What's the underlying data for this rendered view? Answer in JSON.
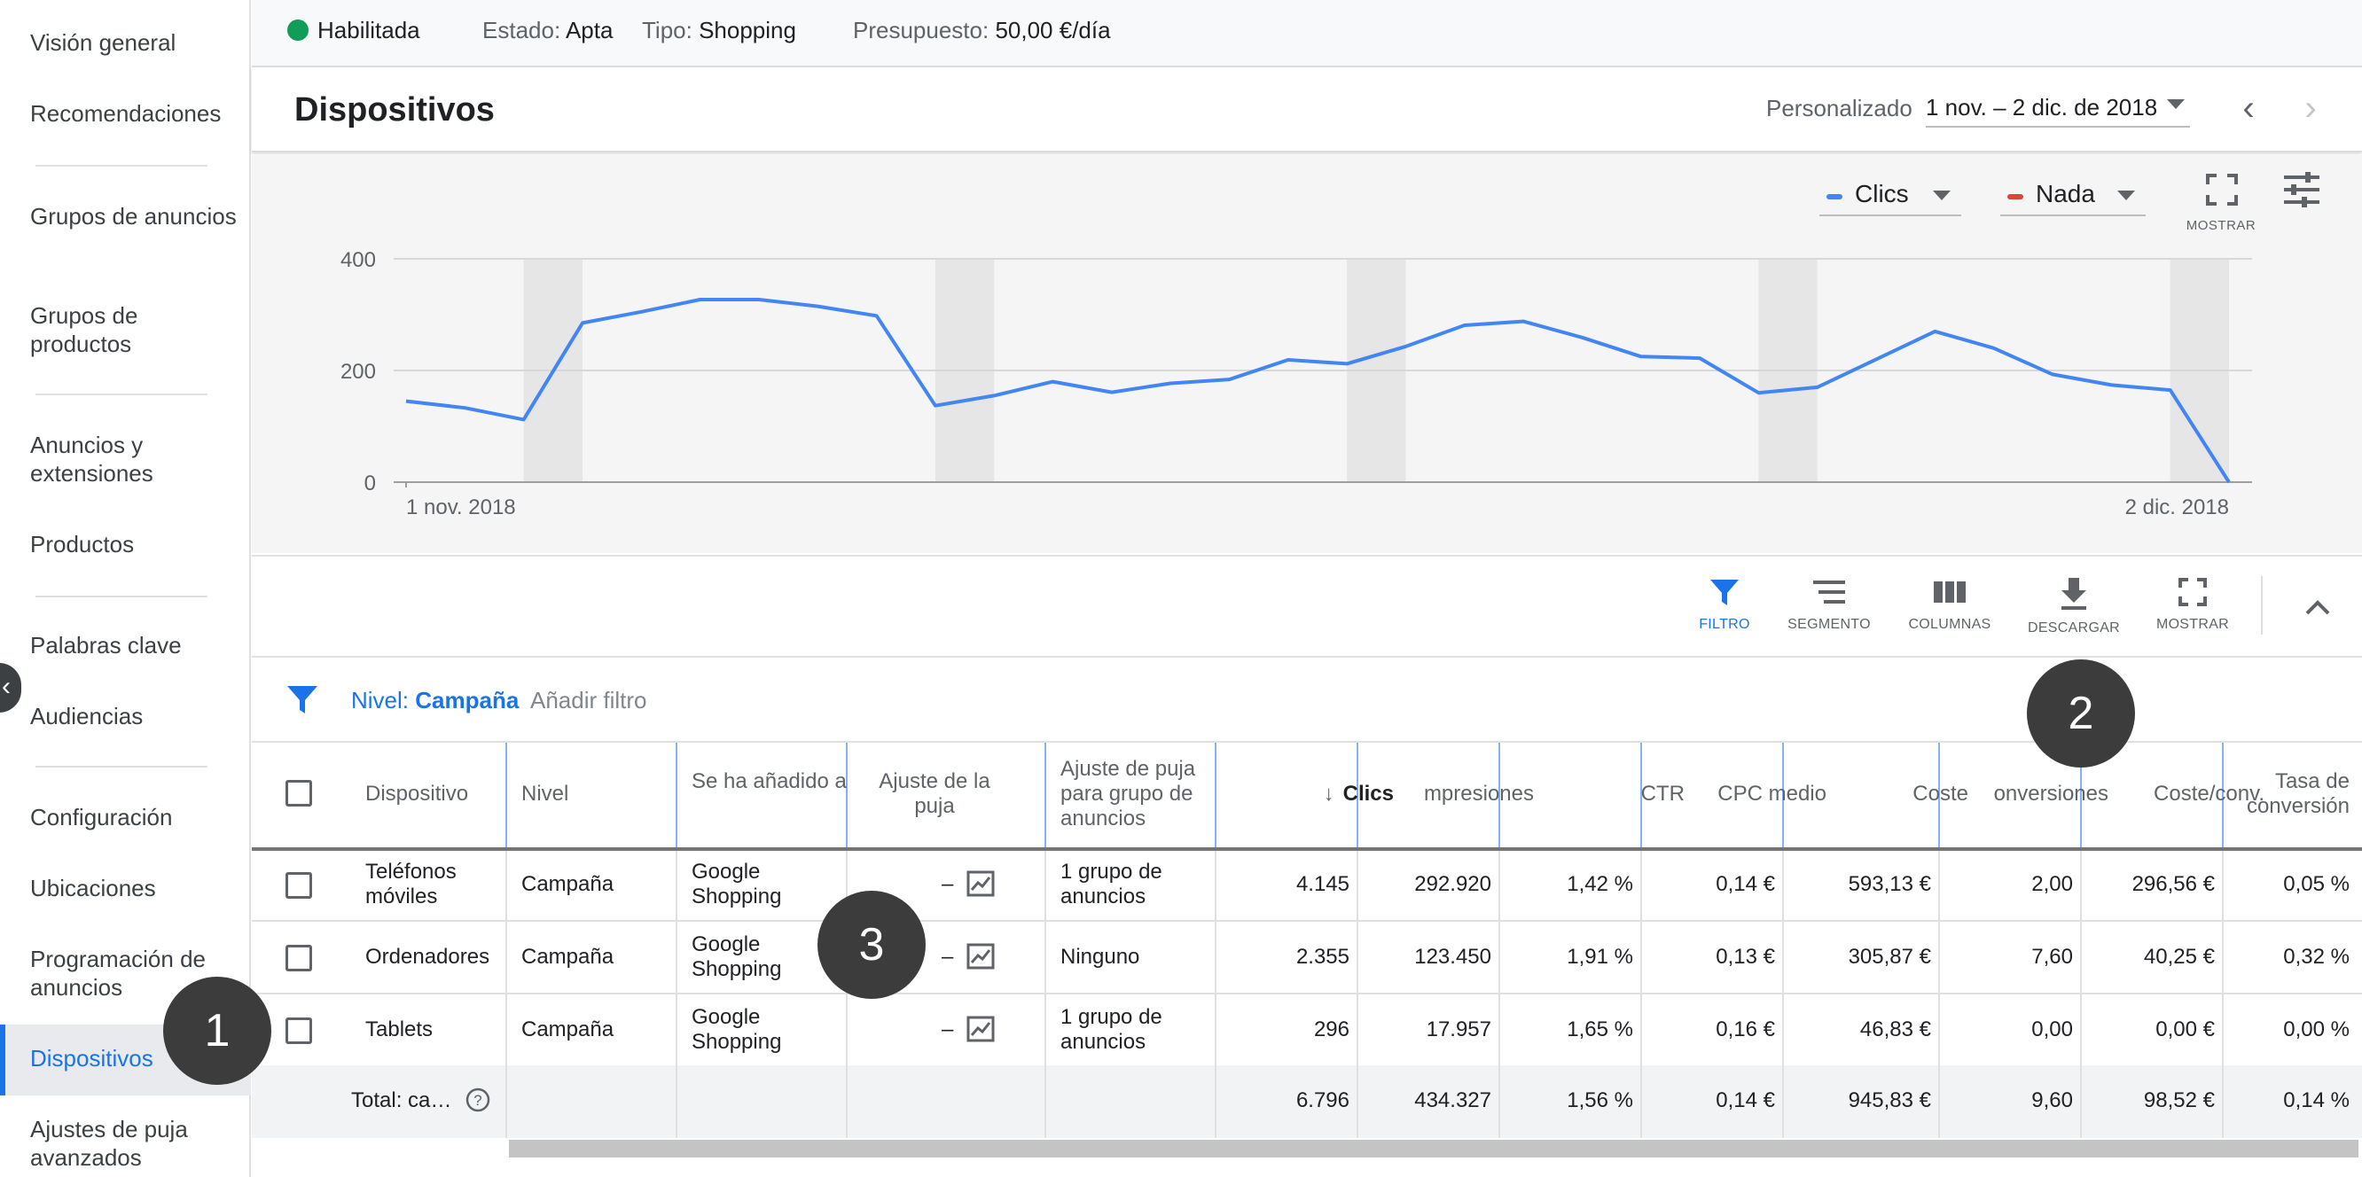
{
  "sidebar": {
    "items": [
      {
        "label": "Visión general"
      },
      {
        "label": "Recomendaciones"
      },
      {
        "label": "Grupos de anuncios"
      },
      {
        "label": "Grupos de productos"
      },
      {
        "label": "Anuncios y extensiones"
      },
      {
        "label": "Productos"
      },
      {
        "label": "Palabras clave"
      },
      {
        "label": "Audiencias"
      },
      {
        "label": "Configuración"
      },
      {
        "label": "Ubicaciones"
      },
      {
        "label": "Programación de anuncios"
      },
      {
        "label": "Dispositivos"
      },
      {
        "label": "Ajustes de puja avanzados"
      }
    ],
    "active": "Dispositivos"
  },
  "statusbar": {
    "status": "Habilitada",
    "estado_label": "Estado:",
    "estado": "Apta",
    "tipo_label": "Tipo:",
    "tipo": "Shopping",
    "presupuesto_label": "Presupuesto:",
    "presupuesto": "50,00 €/día"
  },
  "header": {
    "title": "Dispositivos",
    "date_label": "Personalizado",
    "date_range": "1 nov. – 2 dic. de 2018"
  },
  "chart_controls": {
    "metric1": "Clics",
    "metric1_color": "#4285f4",
    "metric2": "Nada",
    "metric2_color": "#db4437",
    "expand_caption": "MOSTRAR"
  },
  "chart_data": {
    "type": "line",
    "series": [
      {
        "name": "Clics",
        "color": "#4285f4",
        "values": [
          145,
          133,
          112,
          285,
          305,
          327,
          327,
          315,
          298,
          137,
          155,
          180,
          161,
          177,
          184,
          219,
          212,
          243,
          281,
          288,
          259,
          225,
          222,
          160,
          170,
          220,
          270,
          240,
          193,
          174,
          165,
          0
        ]
      }
    ],
    "x_labels": [
      "1 nov. 2018",
      "2 dic. 2018"
    ],
    "yticks": [
      0,
      200,
      400
    ],
    "ylim": [
      0,
      400
    ],
    "shaded_weekends": [
      [
        3,
        4
      ],
      [
        10,
        11
      ],
      [
        17,
        18
      ],
      [
        24,
        25
      ],
      [
        31,
        32
      ]
    ],
    "grid": true
  },
  "toolbar": {
    "filter": "FILTRO",
    "segment": "SEGMENTO",
    "columns": "COLUMNAS",
    "download": "DESCARGAR",
    "expand": "MOSTRAR"
  },
  "filter": {
    "level_label": "Nivel:",
    "level_value": "Campaña",
    "add_filter": "Añadir filtro"
  },
  "table": {
    "headers": {
      "device": "Dispositivo",
      "level": "Nivel",
      "added_to": "Se ha añadido a",
      "bid_adj": "Ajuste de la puja",
      "adgroup_adj": "Ajuste de puja para grupo de anuncios",
      "clicks": "Clics",
      "impressions": "mpresiones",
      "ctr": "CTR",
      "cpc": "CPC medio",
      "cost": "Coste",
      "conversions": "onversiones",
      "cost_conv": "Coste/conv.",
      "conv_rate": "Tasa de conversión"
    },
    "rows": [
      {
        "device": "Teléfonos móviles",
        "level": "Campaña",
        "added_to": "Google Shopping",
        "bid_adj": "–",
        "adgroup_adj": "1 grupo de anuncios",
        "clicks": "4.145",
        "impressions": "292.920",
        "ctr": "1,42 %",
        "cpc": "0,14 €",
        "cost": "593,13 €",
        "conversions": "2,00",
        "cost_conv": "296,56 €",
        "conv_rate": "0,05 %"
      },
      {
        "device": "Ordenadores",
        "level": "Campaña",
        "added_to": "Google Shopping",
        "bid_adj": "–",
        "adgroup_adj": "Ninguno",
        "clicks": "2.355",
        "impressions": "123.450",
        "ctr": "1,91 %",
        "cpc": "0,13 €",
        "cost": "305,87 €",
        "conversions": "7,60",
        "cost_conv": "40,25 €",
        "conv_rate": "0,32 %"
      },
      {
        "device": "Tablets",
        "level": "Campaña",
        "added_to": "Google Shopping",
        "bid_adj": "–",
        "adgroup_adj": "1 grupo de anuncios",
        "clicks": "296",
        "impressions": "17.957",
        "ctr": "1,65 %",
        "cpc": "0,16 €",
        "cost": "46,83 €",
        "conversions": "0,00",
        "cost_conv": "0,00 €",
        "conv_rate": "0,00 %"
      }
    ],
    "total": {
      "label": "Total: ca…",
      "clicks": "6.796",
      "impressions": "434.327",
      "ctr": "1,56 %",
      "cpc": "0,14 €",
      "cost": "945,83 €",
      "conversions": "9,60",
      "cost_conv": "98,52 €",
      "conv_rate": "0,14 %"
    }
  },
  "callouts": [
    "1",
    "2",
    "3"
  ]
}
